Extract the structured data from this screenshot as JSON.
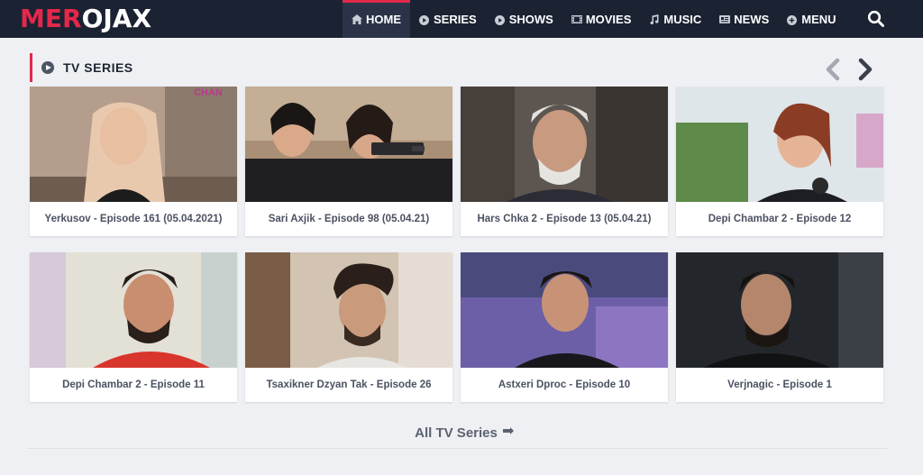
{
  "brand": {
    "logo_part1": "MER",
    "logo_part2": "OJAX"
  },
  "nav": {
    "items": [
      {
        "label": "HOME",
        "icon": "home-icon",
        "active": true
      },
      {
        "label": "SERIES",
        "icon": "play-circle-icon"
      },
      {
        "label": "SHOWS",
        "icon": "play-circle-icon"
      },
      {
        "label": "MOVIES",
        "icon": "film-icon"
      },
      {
        "label": "MUSIC",
        "icon": "music-icon"
      },
      {
        "label": "NEWS",
        "icon": "newspaper-icon"
      },
      {
        "label": "MENU",
        "icon": "plus-circle-icon"
      }
    ],
    "search_icon": "search-icon"
  },
  "section": {
    "title": "TV SERIES"
  },
  "cards": [
    {
      "title": "Yerkusov - Episode 161 (05.04.2021)",
      "thumb_text": "CHAN"
    },
    {
      "title": "Sari Axjik - Episode 98 (05.04.21)"
    },
    {
      "title": "Hars Chka 2 - Episode 13 (05.04.21)"
    },
    {
      "title": "Depi Chambar 2 - Episode 12"
    },
    {
      "title": "Depi Chambar 2 - Episode 11"
    },
    {
      "title": "Tsaxikner Dzyan Tak - Episode 26"
    },
    {
      "title": "Astxeri Dproc - Episode 10"
    },
    {
      "title": "Verjnagic - Episode 1"
    }
  ],
  "footer": {
    "all_label": "All TV Series",
    "all_icon": "flag-arrow-icon"
  },
  "colors": {
    "accent": "#e3284b",
    "header_bg": "#1b2232",
    "page_bg": "#eef0f3"
  }
}
